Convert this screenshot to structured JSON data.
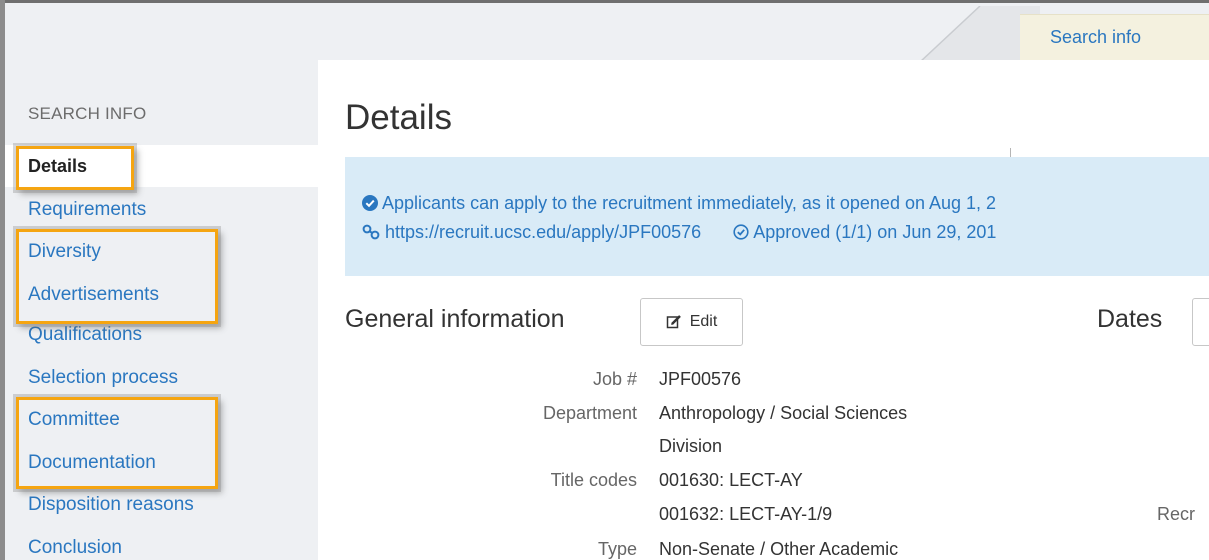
{
  "tab": {
    "label": "Search info"
  },
  "sidebar": {
    "heading": "SEARCH INFO",
    "items": [
      {
        "label": "Details"
      },
      {
        "label": "Requirements"
      },
      {
        "label": "Diversity"
      },
      {
        "label": "Advertisements"
      },
      {
        "label": "Qualifications"
      },
      {
        "label": "Selection process"
      },
      {
        "label": "Committee"
      },
      {
        "label": "Documentation"
      },
      {
        "label": "Disposition reasons"
      },
      {
        "label": "Conclusion"
      }
    ]
  },
  "main": {
    "title": "Details",
    "alert": {
      "line1": "Applicants can apply to the recruitment immediately, as it opened on Aug 1, 2",
      "url": "https://recruit.ucsc.edu/apply/JPF00576",
      "approval": "Approved (1/1) on Jun 29, 201"
    },
    "general": {
      "title": "General information",
      "edit_label": "Edit",
      "fields": {
        "job_label": "Job #",
        "job_value": "JPF00576",
        "department_label": "Department",
        "department_value_1": "Anthropology / Social Sciences",
        "department_value_2": "Division",
        "title_codes_label": "Title codes",
        "title_code_1": "001630: LECT-AY",
        "title_code_2": "001632: LECT-AY-1/9",
        "type_label": "Type",
        "type_value": "Non-Senate / Other Academic"
      }
    },
    "dates": {
      "title": "Dates",
      "cut_label": "Recr"
    }
  },
  "colors": {
    "link": "#2a77c0",
    "highlight": "#f5a511",
    "alert_bg": "#d9ebf7",
    "tab_bg": "#f4f1df"
  }
}
